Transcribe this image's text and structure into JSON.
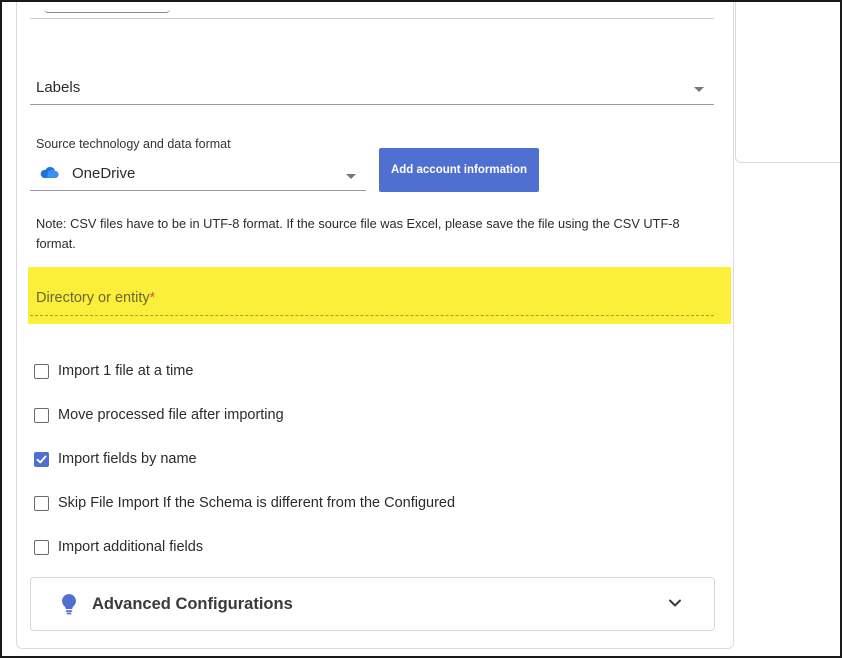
{
  "labels_select": {
    "value": "Labels"
  },
  "source": {
    "label": "Source technology and data format",
    "value": "OneDrive",
    "icon": "onedrive-cloud-icon",
    "add_account_button": "Add account information"
  },
  "note": "Note: CSV files have to be in UTF-8 format. If the source file was Excel, please save the file using the CSV UTF-8 format.",
  "directory_field": {
    "label": "Directory or entity",
    "required_marker": "*"
  },
  "options": [
    {
      "label": "Import 1 file at a time",
      "checked": false
    },
    {
      "label": "Move processed file after importing",
      "checked": false
    },
    {
      "label": "Import fields by name",
      "checked": true
    },
    {
      "label": "Skip File Import If the Schema is different from the Configured",
      "checked": false
    },
    {
      "label": "Import additional fields",
      "checked": false
    }
  ],
  "advanced": {
    "title": "Advanced Configurations",
    "icon": "lightbulb-icon",
    "toggle_icon": "chevron-down-icon"
  },
  "colors": {
    "accent": "#4f6fd1",
    "highlight": "#fbef3a",
    "required": "#d9534f"
  }
}
